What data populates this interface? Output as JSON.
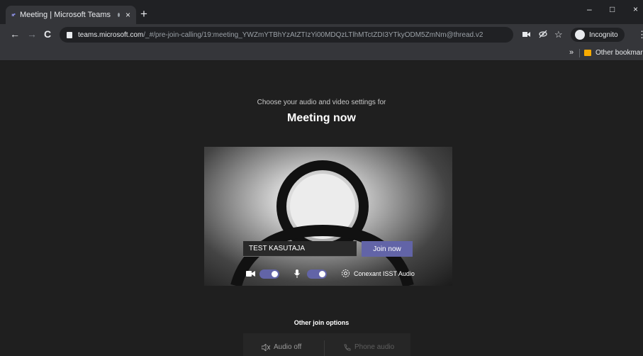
{
  "browser": {
    "tab_title": "Meeting | Microsoft Teams",
    "tab_close": "×",
    "new_tab": "+",
    "url_host": "teams.microsoft.com",
    "url_path": "/_#/pre-join-calling/19:meeting_YWZmYTBhYzAtZTIzYi00MDQzLTlhMTctZDI3YTkyODM5ZmNm@thread.v2",
    "incognito_label": "Incognito",
    "bookmarks_overflow": "»",
    "other_bookmarks": "Other bookmarks",
    "window_minimize": "–",
    "window_maximize": "□",
    "window_close": "×",
    "back": "←",
    "forward": "→",
    "reload": "C",
    "star": "☆",
    "menu": "⋮"
  },
  "prejoin": {
    "subtitle": "Choose your audio and video settings for",
    "title": "Meeting now",
    "name_value": "TEST KASUTAJA",
    "join_label": "Join now",
    "camera_on": true,
    "mic_on": true,
    "audio_device": "Conexant ISST Audio"
  },
  "other_options": {
    "title": "Other join options",
    "audio_off_label": "Audio off",
    "phone_audio_label": "Phone audio"
  },
  "colors": {
    "teams_purple": "#6264a7",
    "page_bg": "#1f1f1f",
    "chrome_tab": "#35363a"
  }
}
